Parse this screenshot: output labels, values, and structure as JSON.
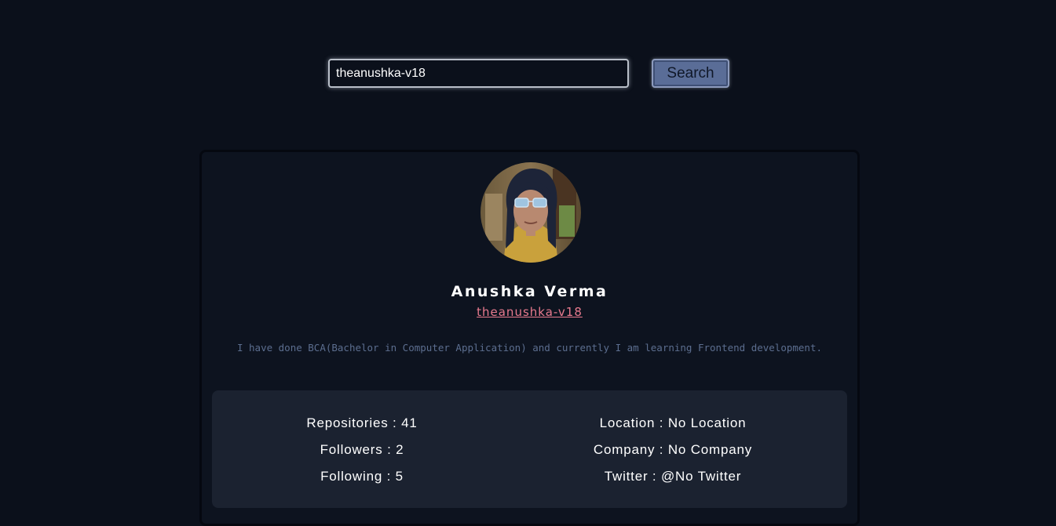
{
  "search": {
    "value": "theanushka-v18",
    "button_label": "Search"
  },
  "profile": {
    "avatar_icon": "user-avatar-photo",
    "name": "Anushka Verma",
    "login": "theanushka-v18",
    "bio": "I have done BCA(Bachelor in Computer Application) and currently I am learning Frontend development."
  },
  "stats": {
    "repositories": "Repositories : 41",
    "followers": "Followers : 2",
    "following": "Following : 5",
    "location": "Location : No Location",
    "company": "Company : No Company",
    "twitter": "Twitter : @No Twitter"
  },
  "colors": {
    "background": "#0b101b",
    "card": "#0d131f",
    "stats_panel": "#1b2230",
    "accent_link": "#e87a8e",
    "bio_text": "#5c6e8f",
    "button": "#5a6d97"
  }
}
